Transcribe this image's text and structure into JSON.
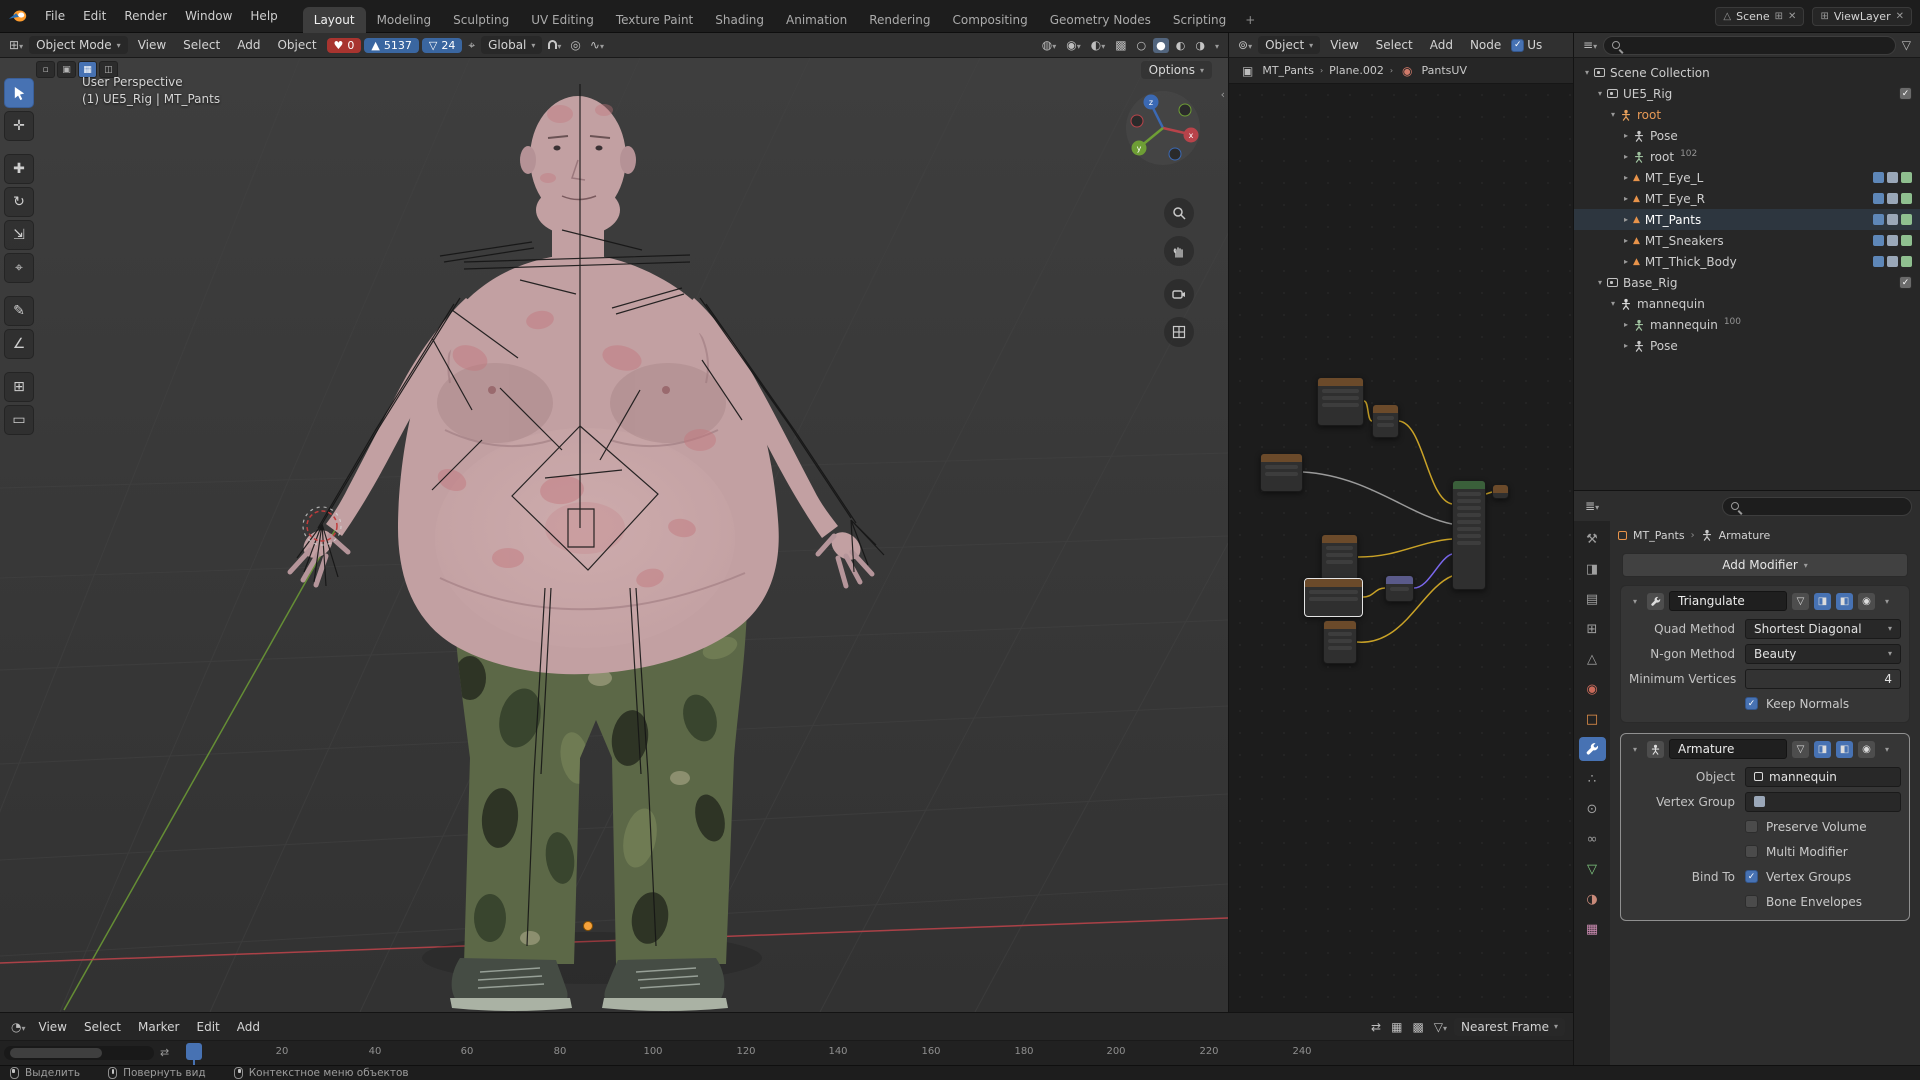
{
  "topbar": {
    "menus": [
      "File",
      "Edit",
      "Render",
      "Window",
      "Help"
    ],
    "tabs": [
      "Layout",
      "Modeling",
      "Sculpting",
      "UV Editing",
      "Texture Paint",
      "Shading",
      "Animation",
      "Rendering",
      "Compositing",
      "Geometry Nodes",
      "Scripting"
    ],
    "add_tab": "+",
    "scene": "Scene",
    "viewlayer": "ViewLayer"
  },
  "vp_header": {
    "mode": "Object Mode",
    "menus": [
      "View",
      "Select",
      "Add",
      "Object"
    ],
    "stats": {
      "red": "0",
      "blue": "5137",
      "filter": "24"
    },
    "orientation": "Global",
    "options": "Options"
  },
  "viewport": {
    "overlay1": "User Perspective",
    "overlay2": "(1) UE5_Rig | MT_Pants",
    "axis": {
      "x": "x",
      "y": "y",
      "z": "z"
    }
  },
  "node_editor": {
    "object_selector": "Object",
    "menus": [
      "View",
      "Select",
      "Add",
      "Node"
    ],
    "use_nodes": "Us",
    "breadcrumb": [
      "MT_Pants",
      "Plane.002",
      "PantsUV"
    ]
  },
  "outliner": {
    "rows": [
      {
        "label": "Scene Collection"
      },
      {
        "label": "UE5_Rig"
      },
      {
        "label": "root"
      },
      {
        "label": "Pose"
      },
      {
        "label": "root",
        "badge": "102"
      },
      {
        "label": "MT_Eye_L"
      },
      {
        "label": "MT_Eye_R"
      },
      {
        "label": "MT_Pants"
      },
      {
        "label": "MT_Sneakers"
      },
      {
        "label": "MT_Thick_Body"
      },
      {
        "label": "Base_Rig"
      },
      {
        "label": "mannequin"
      },
      {
        "label": "mannequin",
        "badge": "100"
      },
      {
        "label": "Pose"
      }
    ]
  },
  "properties": {
    "breadcrumb": [
      "MT_Pants",
      "Armature"
    ],
    "add_modifier": "Add Modifier",
    "triangulate": {
      "name": "Triangulate",
      "quad_method_label": "Quad Method",
      "quad_method_value": "Shortest Diagonal",
      "ngon_method_label": "N-gon Method",
      "ngon_method_value": "Beauty",
      "min_vertices_label": "Minimum Vertices",
      "min_vertices_value": "4",
      "keep_normals_label": "Keep Normals"
    },
    "armature": {
      "name": "Armature",
      "object_label": "Object",
      "object_value": "mannequin",
      "vertex_group_label": "Vertex Group",
      "preserve_volume_label": "Preserve Volume",
      "multi_modifier_label": "Multi Modifier",
      "bind_to_label": "Bind To",
      "vertex_groups_label": "Vertex Groups",
      "bone_envelopes_label": "Bone Envelopes"
    }
  },
  "timeline": {
    "menus": [
      "View",
      "Select",
      "Marker",
      "Edit",
      "Add"
    ],
    "ticks": [
      "20",
      "40",
      "60",
      "80",
      "100",
      "120",
      "140",
      "160",
      "180",
      "200",
      "220",
      "240"
    ],
    "snap_mode": "Nearest Frame"
  },
  "statusbar": {
    "left": "Выделить",
    "middle": "Повернуть вид",
    "right": "Контекстное меню объектов"
  },
  "colors": {
    "accent": "#4772b3",
    "object_orange": "#e8934a",
    "axis_x": "#b8434a",
    "axis_y": "#6e9e35",
    "axis_z": "#3b69b3",
    "wire_yellow": "#c9a227"
  }
}
